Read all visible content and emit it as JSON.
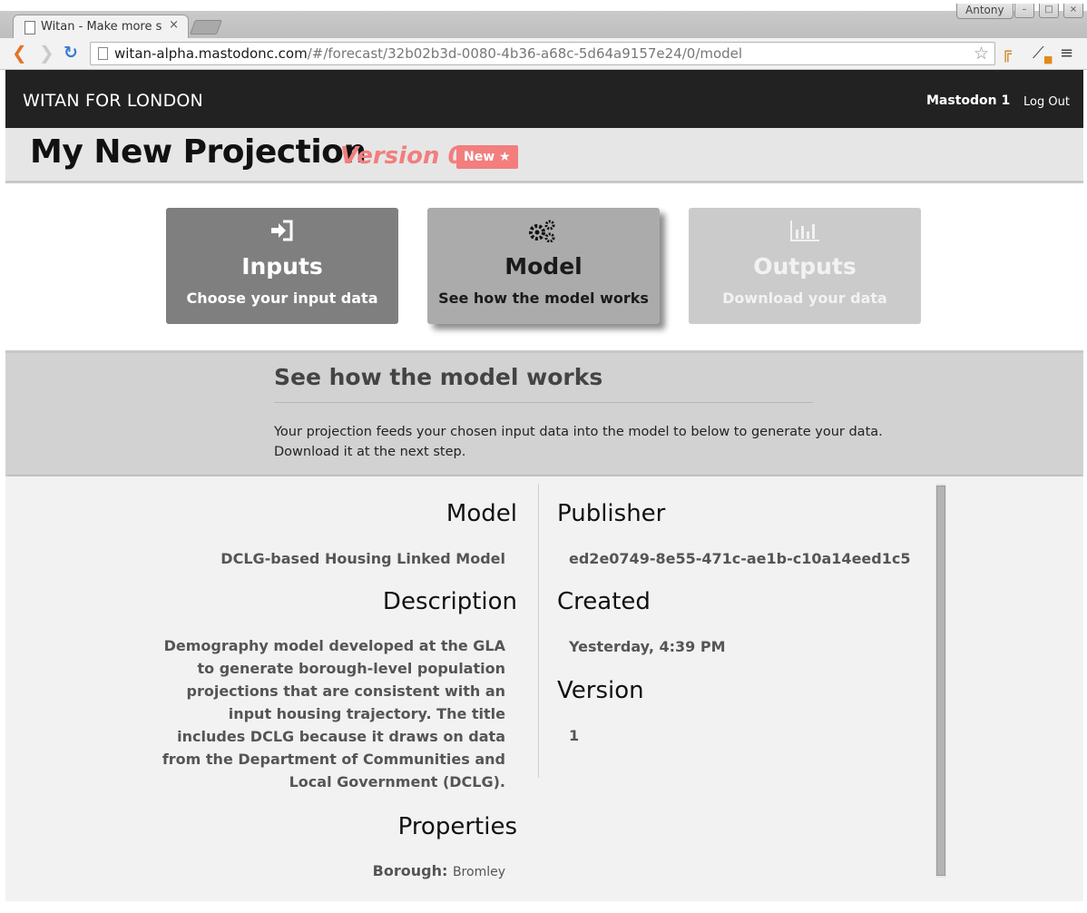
{
  "browser": {
    "tab_title": "Witan - Make more s",
    "tab_close": "×",
    "user_chip": "Antony",
    "url_host": "witan-alpha.mastodonc.com",
    "url_path": "/#/forecast/32b02b3d-0080-4b36-a68c-5d64a9157e24/0/model",
    "window_buttons": [
      "–",
      "□",
      "×"
    ]
  },
  "nav": {
    "brand": "WITAN FOR LONDON",
    "user": "Mastodon 1",
    "logout": "Log Out"
  },
  "projection": {
    "title": "My New Projection",
    "version": "Version 0",
    "badge": "New"
  },
  "steps": [
    {
      "title": "Inputs",
      "subtitle": "Choose your input data",
      "icon": "sign-in-icon"
    },
    {
      "title": "Model",
      "subtitle": "See how the model works",
      "icon": "gears-icon"
    },
    {
      "title": "Outputs",
      "subtitle": "Download your data",
      "icon": "bar-chart-icon"
    }
  ],
  "info": {
    "heading": "See how the model works",
    "text_line1": "Your projection feeds your chosen input data into the model to below to generate your data.",
    "text_line2": "Download it at the next step."
  },
  "details": {
    "model_label": "Model",
    "model_value": "DCLG-based Housing Linked Model",
    "description_label": "Description",
    "description_value": "Demography model developed at the GLA to generate borough-level population projections that are consistent with an input housing trajectory. The title includes DCLG because it draws on data from the Department of Communities and Local Government (DCLG).",
    "properties_label": "Properties",
    "property_key": "Borough:",
    "property_value": "Bromley",
    "publisher_label": "Publisher",
    "publisher_value": "ed2e0749-8e55-471c-ae1b-c10a14eed1c5",
    "created_label": "Created",
    "created_value": "Yesterday, 4:39 PM",
    "version_label": "Version",
    "version_value": "1"
  },
  "colors": {
    "accent": "#f27e7e",
    "navbar": "#222222",
    "inputs_card": "#7f7f7f",
    "model_card": "#ababab",
    "outputs_card": "#cbcbcb"
  }
}
